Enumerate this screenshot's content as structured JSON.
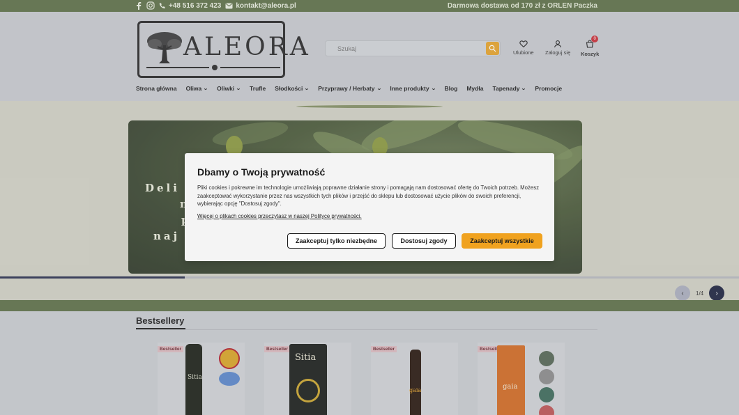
{
  "topbar": {
    "phone": "+48 516 372 423",
    "email": "kontakt@aleora.pl",
    "promo": "Darmowa dostawa od 170 zł z ORLEN Paczka",
    "icons": [
      "facebook-icon",
      "instagram-icon",
      "phone-icon",
      "mail-icon"
    ]
  },
  "header": {
    "logo_text": "ALEORA",
    "search_placeholder": "Szukaj",
    "favorites_label": "Ulubione",
    "login_label": "Zaloguj się",
    "cart_label": "Koszyk",
    "cart_count": "0"
  },
  "nav": {
    "items": [
      {
        "label": "Strona główna",
        "dropdown": false
      },
      {
        "label": "Oliwa",
        "dropdown": true
      },
      {
        "label": "Oliwki",
        "dropdown": true
      },
      {
        "label": "Trufle",
        "dropdown": false
      },
      {
        "label": "Słodkości",
        "dropdown": true
      },
      {
        "label": "Przyprawy / Herbaty",
        "dropdown": true
      },
      {
        "label": "Inne produkty",
        "dropdown": true
      },
      {
        "label": "Blog",
        "dropdown": false
      },
      {
        "label": "Mydła",
        "dropdown": false
      },
      {
        "label": "Tapenady",
        "dropdown": true
      },
      {
        "label": "Promocje",
        "dropdown": false
      }
    ]
  },
  "hero": {
    "lines": [
      "Deli",
      "n",
      "p",
      "naj"
    ],
    "slide_counter": "1/4",
    "progress": 0.25
  },
  "bestsellers": {
    "title": "Bestsellery",
    "tag": "Bestseller",
    "product_labels": [
      "Sitia",
      "Sitia",
      "gaia",
      "gaia"
    ]
  },
  "cookie": {
    "title": "Dbamy o Twoją prywatność",
    "body": "Pliki cookies i pokrewne im technologie umożliwiają poprawne działanie strony i pomagają nam dostosować ofertę do Twoich potrzeb. Możesz zaakceptować wykorzystanie przez nas wszystkich tych plików i przejść do sklepu lub dostosować użycie plików do swoich preferencji, wybierając opcję \"Dostosuj zgody\".",
    "more_link": "Więcej o plikach cookies przeczytasz w naszej Polityce prywatności.",
    "btn_necessary": "Zaakceptuj tylko niezbędne",
    "btn_customize": "Dostosuj zgody",
    "btn_accept_all": "Zaakceptuj wszystkie"
  },
  "colors": {
    "brand_green": "#5e7048",
    "accent_orange": "#f0a21f",
    "cart_badge": "#c8323a",
    "slider_dark": "#1f2540"
  }
}
